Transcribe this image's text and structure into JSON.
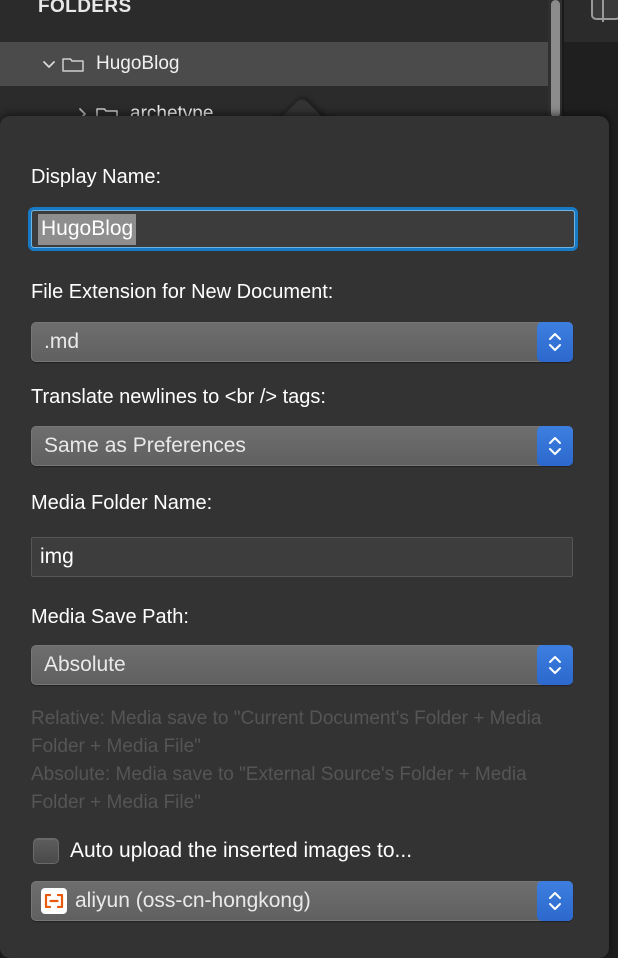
{
  "sidebar": {
    "header": "FOLDERS",
    "rows": [
      {
        "label": "HugoBlog",
        "icon": "folder-icon",
        "twisty": "chevron-down-icon",
        "selected": true
      },
      {
        "label": "archetype",
        "icon": "folder-icon",
        "twisty": "chevron-right-icon",
        "selected": false
      }
    ]
  },
  "popover": {
    "display_name": {
      "label": "Display Name:",
      "value": "HugoBlog"
    },
    "file_extension": {
      "label": "File Extension for New Document:",
      "value": ".md"
    },
    "translate_newlines": {
      "label": "Translate newlines to <br /> tags:",
      "value": "Same as Preferences"
    },
    "media_folder_name": {
      "label": "Media Folder Name:",
      "value": "img"
    },
    "media_save_path": {
      "label": "Media Save Path:",
      "value": "Absolute"
    },
    "help_text": "Relative: Media save to \"Current Document's Folder + Media Folder + Media File\"\nAbsolute: Media save to \"External Source's Folder + Media Folder + Media File\"",
    "auto_upload": {
      "label": "Auto upload the inserted images to...",
      "checked": false
    },
    "upload_target": {
      "value": "aliyun (oss-cn-hongkong)",
      "icon": "aliyun-logo-icon"
    }
  },
  "colors": {
    "popover_bg": "#333333",
    "sidebar_bg": "#2b2b2b",
    "selected_row": "#4b4b4b",
    "focus_ring": "#1879c4",
    "popup_arrow_blue": "#2c68cd",
    "aliyun_orange": "#e8590c",
    "help_text": "#555555"
  }
}
